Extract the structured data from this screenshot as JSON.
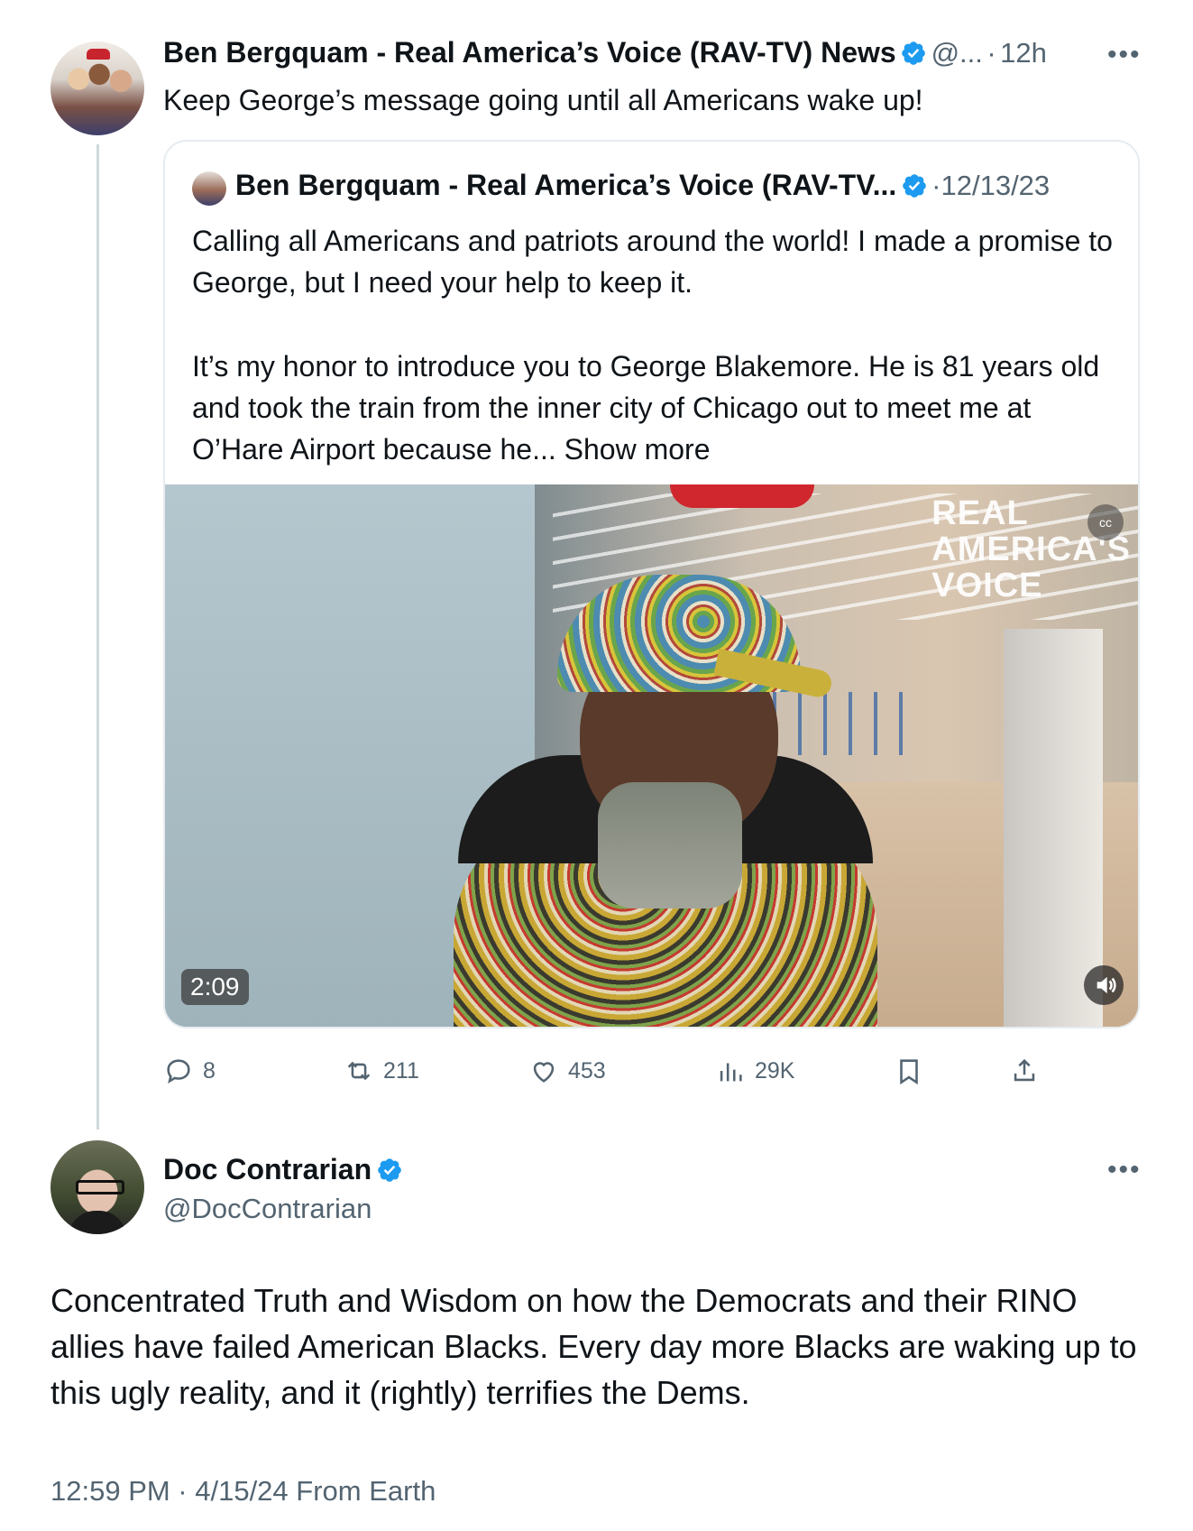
{
  "top_tweet": {
    "author_name": "Ben Bergquam - Real America’s Voice (RAV-TV) News",
    "handle_short": "@...",
    "separator": "·",
    "time": "12h",
    "text": "Keep George’s message going until all Americans wake up!",
    "more_icon": "ellipsis-icon",
    "quote": {
      "author_name": "Ben Bergquam - Real America’s Voice (RAV-TV...",
      "date": "·12/13/23",
      "paragraph1": "Calling all Americans and patriots around the world! I made a promise to George, but I need your help to keep it.",
      "paragraph2": "It’s my honor to introduce you to George Blakemore. He is 81 years old and took the train from the inner city of Chicago out to meet me at O’Hare Airport because he...",
      "show_more": "Show more",
      "video": {
        "watermark_line1": "REAL",
        "watermark_line2": "AMERICA'S",
        "watermark_line3": "VOICE",
        "duration": "2:09"
      }
    },
    "actions": {
      "replies": "8",
      "reposts": "211",
      "likes": "453",
      "views": "29K"
    }
  },
  "main_tweet": {
    "author_name": "Doc Contrarian",
    "handle": "@DocContrarian",
    "text": "Concentrated Truth and Wisdom on how the Democrats and their RINO allies have failed American Blacks. Every day more Blacks are waking up to this ugly reality, and it (rightly) terrifies the Dems.",
    "timestamp": "12:59 PM · 4/15/24 From Earth"
  },
  "colors": {
    "verified_blue": "#1d9bf0",
    "secondary_text": "#536471",
    "border": "#e6ecf0"
  }
}
